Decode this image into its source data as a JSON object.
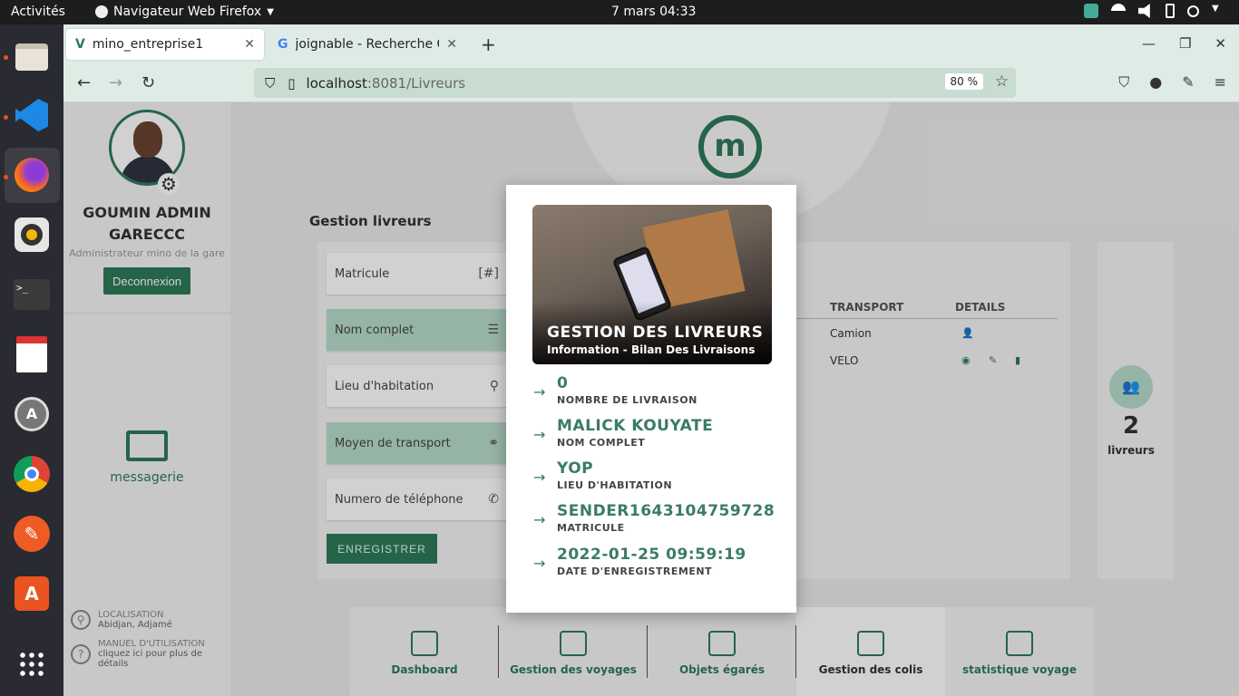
{
  "system": {
    "activities": "Activités",
    "app_name": "Navigateur Web Firefox",
    "clock": "7 mars  04:33"
  },
  "browser": {
    "tabs": [
      {
        "label": "mino_entreprise1"
      },
      {
        "label": "joignable - Recherche Go"
      }
    ],
    "url_host": "localhost",
    "url_path": ":8081/Livreurs",
    "zoom": "80 %"
  },
  "sidebar": {
    "user_name": "GOUMIN ADMIN GARECCC",
    "user_role": "Administrateur mino de la gare",
    "logout_label": "Deconnexion",
    "messaging_label": "messagerie",
    "location_label": "LOCALISATION",
    "location_value": "Abidjan, Adjamé",
    "manual_label": "MANUEL D'UTILISATION",
    "manual_value": "cliquez ici pour plus de détails"
  },
  "main": {
    "section_title": "Gestion livreurs",
    "form": {
      "matricule": "Matricule",
      "nom_complet": "Nom complet",
      "lieu": "Lieu d'habitation",
      "transport": "Moyen de transport",
      "telephone": "Numero de téléphone",
      "save_label": "ENREGISTRER"
    },
    "table": {
      "headers": [
        "TRANSPORT",
        "DETAILS"
      ],
      "rows": [
        {
          "transport": "Camion"
        },
        {
          "transport": "VELO"
        }
      ]
    },
    "stat": {
      "value": "2",
      "label": "livreurs"
    },
    "bottom_nav": [
      {
        "label": "Dashboard"
      },
      {
        "label": "Gestion des voyages"
      },
      {
        "label": "Objets égarés"
      },
      {
        "label": "Gestion des colis"
      },
      {
        "label": "statistique voyage"
      }
    ]
  },
  "modal": {
    "title": "GESTION DES LIVREURS",
    "subtitle": "Information - Bilan Des Livraisons",
    "items": [
      {
        "value": "0",
        "label": "NOMBRE DE LIVRAISON"
      },
      {
        "value": "MALICK KOUYATE",
        "label": "NOM COMPLET"
      },
      {
        "value": "YOP",
        "label": "LIEU D'HABITATION"
      },
      {
        "value": "SENDER1643104759728",
        "label": "MATRICULE"
      },
      {
        "value": "2022-01-25 09:59:19",
        "label": "DATE D'ENREGISTREMENT"
      }
    ]
  },
  "colors": {
    "accent": "#2f7a5a",
    "accent_light": "#b8dccb"
  }
}
